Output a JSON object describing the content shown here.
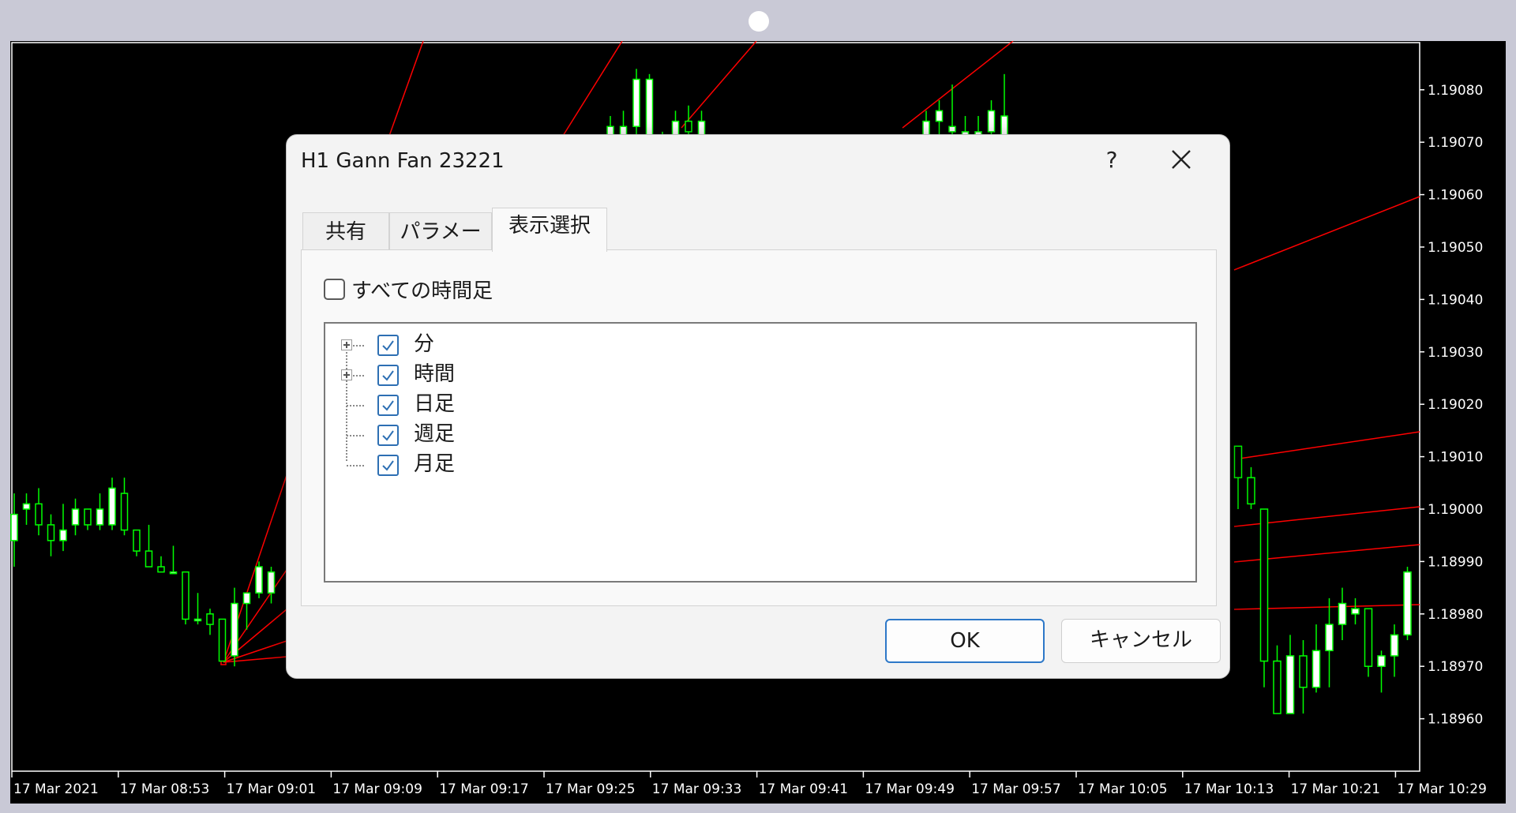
{
  "dialog": {
    "title": "H1 Gann Fan 23221",
    "help": "?",
    "tabs": [
      {
        "label": "共有",
        "active": false
      },
      {
        "label": "パラメータ",
        "active": false
      },
      {
        "label": "表示選択",
        "active": true
      }
    ],
    "all_timeframes": {
      "label": "すべての時間足",
      "checked": false
    },
    "tree": [
      {
        "label": "分",
        "checked": true,
        "expandable": true
      },
      {
        "label": "時間",
        "checked": true,
        "expandable": true
      },
      {
        "label": "日足",
        "checked": true,
        "expandable": false
      },
      {
        "label": "週足",
        "checked": true,
        "expandable": false
      },
      {
        "label": "月足",
        "checked": true,
        "expandable": false
      }
    ],
    "buttons": {
      "ok": "OK",
      "cancel": "キャンセル"
    }
  },
  "colors": {
    "chart_bg": "#000000",
    "candle": "#00ff00",
    "candle_bull_body": "#ffffff",
    "gann_line": "#ff0000",
    "checkbox": "#2d6fb3",
    "ok_border": "#2d78c8"
  },
  "chart_data": {
    "type": "candlestick",
    "price_ticks": [
      "1.19080",
      "1.19070",
      "1.19060",
      "1.19050",
      "1.19040",
      "1.19030",
      "1.19020",
      "1.19010",
      "1.19000",
      "1.18990",
      "1.18980",
      "1.18970",
      "1.18960"
    ],
    "price_range": [
      1.1895,
      1.19089
    ],
    "time_ticks": [
      "17 Mar 2021",
      "17 Mar 08:53",
      "17 Mar 09:01",
      "17 Mar 09:09",
      "17 Mar 09:17",
      "17 Mar 09:25",
      "17 Mar 09:33",
      "17 Mar 09:41",
      "17 Mar 09:49",
      "17 Mar 09:57",
      "17 Mar 10:05",
      "17 Mar 10:13",
      "17 Mar 10:21",
      "17 Mar 10:29"
    ],
    "candles": [
      {
        "o": 1.18994,
        "h": 1.19003,
        "l": 1.18989,
        "c": 1.18999
      },
      {
        "o": 1.19,
        "h": 1.19003,
        "l": 1.18997,
        "c": 1.19001
      },
      {
        "o": 1.19001,
        "h": 1.19004,
        "l": 1.18995,
        "c": 1.18997
      },
      {
        "o": 1.18997,
        "h": 1.18999,
        "l": 1.18991,
        "c": 1.18994
      },
      {
        "o": 1.18994,
        "h": 1.19001,
        "l": 1.18992,
        "c": 1.18996
      },
      {
        "o": 1.18997,
        "h": 1.19002,
        "l": 1.18995,
        "c": 1.19
      },
      {
        "o": 1.19,
        "h": 1.19,
        "l": 1.18996,
        "c": 1.18997
      },
      {
        "o": 1.18997,
        "h": 1.19003,
        "l": 1.18996,
        "c": 1.19
      },
      {
        "o": 1.18997,
        "h": 1.19006,
        "l": 1.18996,
        "c": 1.19004
      },
      {
        "o": 1.19003,
        "h": 1.19006,
        "l": 1.18995,
        "c": 1.18996
      },
      {
        "o": 1.18996,
        "h": 1.18996,
        "l": 1.18991,
        "c": 1.18992
      },
      {
        "o": 1.18992,
        "h": 1.18997,
        "l": 1.18989,
        "c": 1.18989
      },
      {
        "o": 1.18989,
        "h": 1.18991,
        "l": 1.18988,
        "c": 1.18988
      },
      {
        "o": 1.18988,
        "h": 1.18993,
        "l": 1.18988,
        "c": 1.18988
      },
      {
        "o": 1.18988,
        "h": 1.18988,
        "l": 1.18978,
        "c": 1.18979
      },
      {
        "o": 1.18979,
        "h": 1.18984,
        "l": 1.18978,
        "c": 1.18979
      },
      {
        "o": 1.1898,
        "h": 1.18981,
        "l": 1.18976,
        "c": 1.18978
      },
      {
        "o": 1.18979,
        "h": 1.18979,
        "l": 1.18971,
        "c": 1.18971
      },
      {
        "o": 1.18972,
        "h": 1.18985,
        "l": 1.1897,
        "c": 1.18982
      },
      {
        "o": 1.18982,
        "h": 1.18984,
        "l": 1.18977,
        "c": 1.18984
      },
      {
        "o": 1.18984,
        "h": 1.1899,
        "l": 1.18983,
        "c": 1.18989
      },
      {
        "o": 1.18984,
        "h": 1.18989,
        "l": 1.18982,
        "c": 1.18988
      },
      {
        "o": 1.19012,
        "h": 1.19012,
        "l": 1.19,
        "c": 1.19006
      },
      {
        "o": 1.19006,
        "h": 1.19008,
        "l": 1.19,
        "c": 1.19001
      },
      {
        "o": 1.19,
        "h": 1.19,
        "l": 1.18966,
        "c": 1.18971
      },
      {
        "o": 1.18971,
        "h": 1.18974,
        "l": 1.18961,
        "c": 1.18961
      },
      {
        "o": 1.18961,
        "h": 1.18976,
        "l": 1.18961,
        "c": 1.18972
      },
      {
        "o": 1.18972,
        "h": 1.18975,
        "l": 1.18961,
        "c": 1.18966
      },
      {
        "o": 1.18966,
        "h": 1.18978,
        "l": 1.18965,
        "c": 1.18973
      },
      {
        "o": 1.18973,
        "h": 1.18983,
        "l": 1.18966,
        "c": 1.18978
      },
      {
        "o": 1.18978,
        "h": 1.18985,
        "l": 1.18975,
        "c": 1.18982
      },
      {
        "o": 1.1898,
        "h": 1.18983,
        "l": 1.18978,
        "c": 1.18981
      },
      {
        "o": 1.18981,
        "h": 1.18981,
        "l": 1.18968,
        "c": 1.1897
      },
      {
        "o": 1.1897,
        "h": 1.18973,
        "l": 1.18965,
        "c": 1.18972
      },
      {
        "o": 1.18972,
        "h": 1.18978,
        "l": 1.18968,
        "c": 1.18976
      },
      {
        "o": 1.18976,
        "h": 1.18989,
        "l": 1.18975,
        "c": 1.18988
      }
    ],
    "top_candles": [
      {
        "o": 1.19068,
        "h": 1.19075,
        "l": 1.19066,
        "c": 1.19073
      },
      {
        "o": 1.19071,
        "h": 1.19076,
        "l": 1.19068,
        "c": 1.19073
      },
      {
        "o": 1.19073,
        "h": 1.19084,
        "l": 1.19071,
        "c": 1.19082
      },
      {
        "o": 1.19071,
        "h": 1.19083,
        "l": 1.19068,
        "c": 1.19082
      },
      {
        "o": 1.19069,
        "h": 1.19072,
        "l": 1.19066,
        "c": 1.1907
      },
      {
        "o": 1.1907,
        "h": 1.19076,
        "l": 1.19068,
        "c": 1.19074
      },
      {
        "o": 1.19074,
        "h": 1.19077,
        "l": 1.1907,
        "c": 1.19072
      },
      {
        "o": 1.1907,
        "h": 1.19076,
        "l": 1.19068,
        "c": 1.19074
      },
      {
        "o": 1.1907,
        "h": 1.19076,
        "l": 1.19068,
        "c": 1.19074
      },
      {
        "o": 1.19074,
        "h": 1.19078,
        "l": 1.19071,
        "c": 1.19076
      },
      {
        "o": 1.19072,
        "h": 1.19081,
        "l": 1.19068,
        "c": 1.19073
      },
      {
        "o": 1.1907,
        "h": 1.19075,
        "l": 1.19068,
        "c": 1.19072
      },
      {
        "o": 1.1907,
        "h": 1.19075,
        "l": 1.19068,
        "c": 1.19072
      },
      {
        "o": 1.19072,
        "h": 1.19078,
        "l": 1.1907,
        "c": 1.19076
      },
      {
        "o": 1.19069,
        "h": 1.19083,
        "l": 1.19068,
        "c": 1.19075
      }
    ]
  }
}
